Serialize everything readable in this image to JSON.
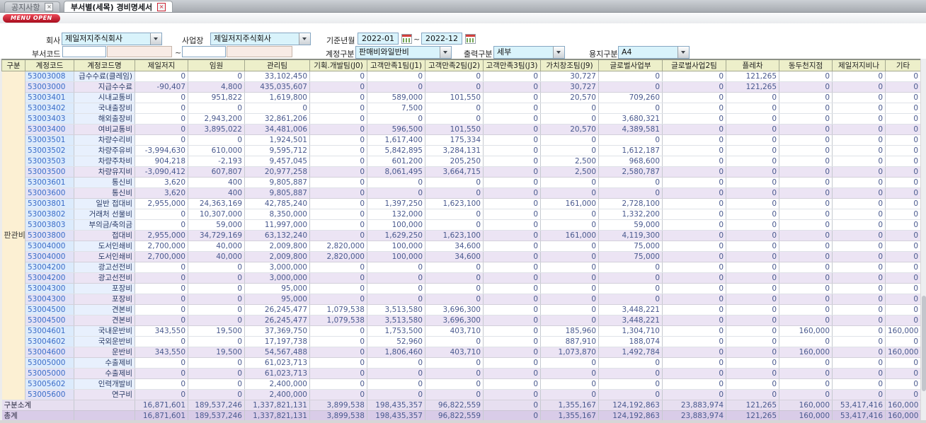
{
  "tabs": [
    {
      "label": "공지사항",
      "close": "×"
    },
    {
      "label": "부서별(세목) 경비명세서",
      "close": "×"
    }
  ],
  "menu_button": "MENU OPEN",
  "filters": {
    "company_label": "회사",
    "company_value": "제일저지주식회사",
    "site_label": "사업장",
    "site_value": "제일저지주식회사",
    "period_label": "기준년월",
    "period_from": "2022-01",
    "period_to": "2022-12",
    "tilde": "~",
    "dept_label": "부서코드",
    "account_label": "계정구분",
    "account_value": "판매비와일반비",
    "output_label": "출력구분",
    "output_value": "세부",
    "paper_label": "용지구분",
    "paper_value": "A4"
  },
  "table": {
    "group_label": "판관비",
    "columns": [
      "구분",
      "계정코드",
      "계정코드명",
      "제일저지",
      "임원",
      "관리팀",
      "기획.개발팀(J0)",
      "고객만족1팀(J1)",
      "고객만족2팀(J2)",
      "고객만족3팀(J3)",
      "가치창조팀(J9)",
      "글로벌사업부",
      "글로벌사업2팀",
      "플레차",
      "동두천지점",
      "제일저지비나",
      "기타"
    ],
    "rows": [
      {
        "code": "53003008",
        "name": "급수수료(클레임)",
        "summary": false,
        "values": [
          "0",
          "0",
          "33,102,450",
          "0",
          "0",
          "0",
          "0",
          "30,727",
          "0",
          "0",
          "121,265",
          "0",
          "0",
          "0"
        ]
      },
      {
        "code": "53003000",
        "name": "지급수수료",
        "summary": true,
        "values": [
          "-90,407",
          "4,800",
          "435,035,607",
          "0",
          "0",
          "0",
          "0",
          "30,727",
          "0",
          "0",
          "121,265",
          "0",
          "0",
          "0"
        ]
      },
      {
        "code": "53003401",
        "name": "시내교통비",
        "summary": false,
        "values": [
          "0",
          "951,822",
          "1,619,800",
          "0",
          "589,000",
          "101,550",
          "0",
          "20,570",
          "709,260",
          "0",
          "0",
          "0",
          "0",
          "0"
        ]
      },
      {
        "code": "53003402",
        "name": "국내출장비",
        "summary": false,
        "values": [
          "0",
          "0",
          "0",
          "0",
          "7,500",
          "0",
          "0",
          "0",
          "0",
          "0",
          "0",
          "0",
          "0",
          "0"
        ]
      },
      {
        "code": "53003403",
        "name": "해외출장비",
        "summary": false,
        "values": [
          "0",
          "2,943,200",
          "32,861,206",
          "0",
          "0",
          "0",
          "0",
          "0",
          "3,680,321",
          "0",
          "0",
          "0",
          "0",
          "0"
        ]
      },
      {
        "code": "53003400",
        "name": "여비교통비",
        "summary": true,
        "values": [
          "0",
          "3,895,022",
          "34,481,006",
          "0",
          "596,500",
          "101,550",
          "0",
          "20,570",
          "4,389,581",
          "0",
          "0",
          "0",
          "0",
          "0"
        ]
      },
      {
        "code": "53003501",
        "name": "차량수리비",
        "summary": false,
        "values": [
          "0",
          "0",
          "1,924,501",
          "0",
          "1,617,400",
          "175,334",
          "0",
          "0",
          "0",
          "0",
          "0",
          "0",
          "0",
          "0"
        ]
      },
      {
        "code": "53003502",
        "name": "차량주유비",
        "summary": false,
        "values": [
          "-3,994,630",
          "610,000",
          "9,595,712",
          "0",
          "5,842,895",
          "3,284,131",
          "0",
          "0",
          "1,612,187",
          "0",
          "0",
          "0",
          "0",
          "0"
        ]
      },
      {
        "code": "53003503",
        "name": "차량주차비",
        "summary": false,
        "values": [
          "904,218",
          "-2,193",
          "9,457,045",
          "0",
          "601,200",
          "205,250",
          "0",
          "2,500",
          "968,600",
          "0",
          "0",
          "0",
          "0",
          "0"
        ]
      },
      {
        "code": "53003500",
        "name": "차량유지비",
        "summary": true,
        "values": [
          "-3,090,412",
          "607,807",
          "20,977,258",
          "0",
          "8,061,495",
          "3,664,715",
          "0",
          "2,500",
          "2,580,787",
          "0",
          "0",
          "0",
          "0",
          "0"
        ]
      },
      {
        "code": "53003601",
        "name": "통신비",
        "summary": false,
        "values": [
          "3,620",
          "400",
          "9,805,887",
          "0",
          "0",
          "0",
          "0",
          "0",
          "0",
          "0",
          "0",
          "0",
          "0",
          "0"
        ]
      },
      {
        "code": "53003600",
        "name": "통신비",
        "summary": true,
        "values": [
          "3,620",
          "400",
          "9,805,887",
          "0",
          "0",
          "0",
          "0",
          "0",
          "0",
          "0",
          "0",
          "0",
          "0",
          "0"
        ]
      },
      {
        "code": "53003801",
        "name": "일반 접대비",
        "summary": false,
        "values": [
          "2,955,000",
          "24,363,169",
          "42,785,240",
          "0",
          "1,397,250",
          "1,623,100",
          "0",
          "161,000",
          "2,728,100",
          "0",
          "0",
          "0",
          "0",
          "0"
        ]
      },
      {
        "code": "53003802",
        "name": "거래처 선물비",
        "summary": false,
        "values": [
          "0",
          "10,307,000",
          "8,350,000",
          "0",
          "132,000",
          "0",
          "0",
          "0",
          "1,332,200",
          "0",
          "0",
          "0",
          "0",
          "0"
        ]
      },
      {
        "code": "53003803",
        "name": "부의금/축의금",
        "summary": false,
        "values": [
          "0",
          "59,000",
          "11,997,000",
          "0",
          "100,000",
          "0",
          "0",
          "0",
          "59,000",
          "0",
          "0",
          "0",
          "0",
          "0"
        ]
      },
      {
        "code": "53003800",
        "name": "접대비",
        "summary": true,
        "values": [
          "2,955,000",
          "34,729,169",
          "63,132,240",
          "0",
          "1,629,250",
          "1,623,100",
          "0",
          "161,000",
          "4,119,300",
          "0",
          "0",
          "0",
          "0",
          "0"
        ]
      },
      {
        "code": "53004000",
        "name": "도서인쇄비",
        "summary": false,
        "values": [
          "2,700,000",
          "40,000",
          "2,009,800",
          "2,820,000",
          "100,000",
          "34,600",
          "0",
          "0",
          "75,000",
          "0",
          "0",
          "0",
          "0",
          "0"
        ]
      },
      {
        "code": "53004000",
        "name": "도서인쇄비",
        "summary": true,
        "values": [
          "2,700,000",
          "40,000",
          "2,009,800",
          "2,820,000",
          "100,000",
          "34,600",
          "0",
          "0",
          "75,000",
          "0",
          "0",
          "0",
          "0",
          "0"
        ]
      },
      {
        "code": "53004200",
        "name": "광고선전비",
        "summary": false,
        "values": [
          "0",
          "0",
          "3,000,000",
          "0",
          "0",
          "0",
          "0",
          "0",
          "0",
          "0",
          "0",
          "0",
          "0",
          "0"
        ]
      },
      {
        "code": "53004200",
        "name": "광고선전비",
        "summary": true,
        "values": [
          "0",
          "0",
          "3,000,000",
          "0",
          "0",
          "0",
          "0",
          "0",
          "0",
          "0",
          "0",
          "0",
          "0",
          "0"
        ]
      },
      {
        "code": "53004300",
        "name": "포장비",
        "summary": false,
        "values": [
          "0",
          "0",
          "95,000",
          "0",
          "0",
          "0",
          "0",
          "0",
          "0",
          "0",
          "0",
          "0",
          "0",
          "0"
        ]
      },
      {
        "code": "53004300",
        "name": "포장비",
        "summary": true,
        "values": [
          "0",
          "0",
          "95,000",
          "0",
          "0",
          "0",
          "0",
          "0",
          "0",
          "0",
          "0",
          "0",
          "0",
          "0"
        ]
      },
      {
        "code": "53004500",
        "name": "견본비",
        "summary": false,
        "values": [
          "0",
          "0",
          "26,245,477",
          "1,079,538",
          "3,513,580",
          "3,696,300",
          "0",
          "0",
          "3,448,221",
          "0",
          "0",
          "0",
          "0",
          "0"
        ]
      },
      {
        "code": "53004500",
        "name": "견본비",
        "summary": true,
        "values": [
          "0",
          "0",
          "26,245,477",
          "1,079,538",
          "3,513,580",
          "3,696,300",
          "0",
          "0",
          "3,448,221",
          "0",
          "0",
          "0",
          "0",
          "0"
        ]
      },
      {
        "code": "53004601",
        "name": "국내운반비",
        "summary": false,
        "values": [
          "343,550",
          "19,500",
          "37,369,750",
          "0",
          "1,753,500",
          "403,710",
          "0",
          "185,960",
          "1,304,710",
          "0",
          "0",
          "160,000",
          "0",
          "160,000"
        ]
      },
      {
        "code": "53004602",
        "name": "국외운반비",
        "summary": false,
        "values": [
          "0",
          "0",
          "17,197,738",
          "0",
          "52,960",
          "0",
          "0",
          "887,910",
          "188,074",
          "0",
          "0",
          "0",
          "0",
          "0"
        ]
      },
      {
        "code": "53004600",
        "name": "운반비",
        "summary": true,
        "values": [
          "343,550",
          "19,500",
          "54,567,488",
          "0",
          "1,806,460",
          "403,710",
          "0",
          "1,073,870",
          "1,492,784",
          "0",
          "0",
          "160,000",
          "0",
          "160,000"
        ]
      },
      {
        "code": "53005000",
        "name": "수출제비",
        "summary": false,
        "values": [
          "0",
          "0",
          "61,023,713",
          "0",
          "0",
          "0",
          "0",
          "0",
          "0",
          "0",
          "0",
          "0",
          "0",
          "0"
        ]
      },
      {
        "code": "53005000",
        "name": "수출제비",
        "summary": true,
        "values": [
          "0",
          "0",
          "61,023,713",
          "0",
          "0",
          "0",
          "0",
          "0",
          "0",
          "0",
          "0",
          "0",
          "0",
          "0"
        ]
      },
      {
        "code": "53005602",
        "name": "인력개발비",
        "summary": false,
        "values": [
          "0",
          "0",
          "2,400,000",
          "0",
          "0",
          "0",
          "0",
          "0",
          "0",
          "0",
          "0",
          "0",
          "0",
          "0"
        ]
      },
      {
        "code": "53005600",
        "name": "연구비",
        "summary": true,
        "values": [
          "0",
          "0",
          "2,400,000",
          "0",
          "0",
          "0",
          "0",
          "0",
          "0",
          "0",
          "0",
          "0",
          "0",
          "0"
        ]
      }
    ],
    "subtotal": {
      "label": "구분소계",
      "values": [
        "16,871,601",
        "189,537,246",
        "1,337,821,131",
        "3,899,538",
        "198,435,357",
        "96,822,559",
        "0",
        "1,355,167",
        "124,192,863",
        "23,883,974",
        "121,265",
        "160,000",
        "53,417,416",
        "160,000"
      ]
    },
    "total": {
      "label": "총계",
      "values": [
        "16,871,601",
        "189,537,246",
        "1,337,821,131",
        "3,899,538",
        "198,435,357",
        "96,822,559",
        "0",
        "1,355,167",
        "124,192,863",
        "23,883,974",
        "121,265",
        "160,000",
        "53,417,416",
        "160,000"
      ]
    }
  }
}
